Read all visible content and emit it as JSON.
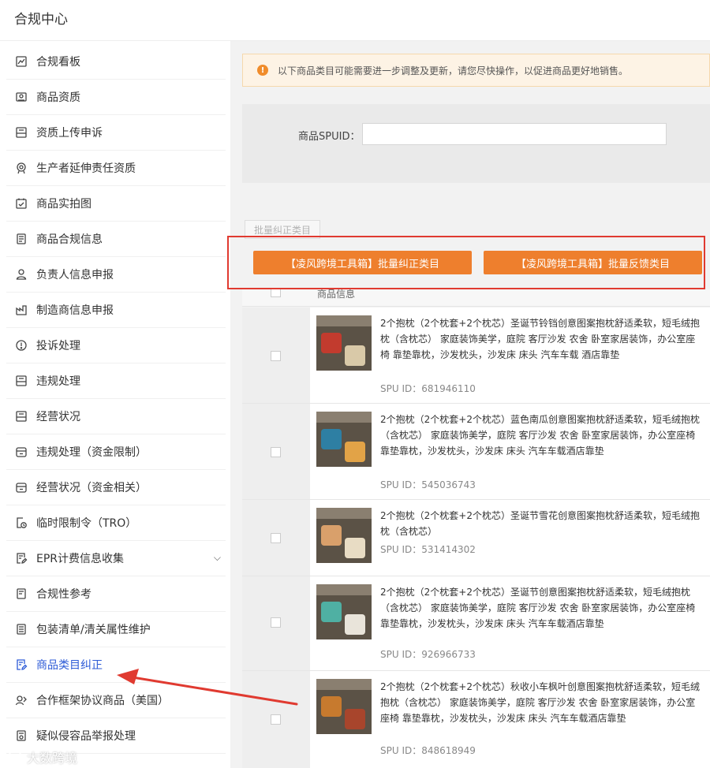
{
  "header": {
    "title": "合规中心"
  },
  "sidebar": {
    "items": [
      {
        "label": "合规看板",
        "icon": "chart-icon"
      },
      {
        "label": "商品资质",
        "icon": "id-card-icon"
      },
      {
        "label": "资质上传申诉",
        "icon": "upload-doc-icon"
      },
      {
        "label": "生产者延伸责任资质",
        "icon": "badge-icon"
      },
      {
        "label": "商品实拍图",
        "icon": "photo-icon"
      },
      {
        "label": "商品合规信息",
        "icon": "document-icon"
      },
      {
        "label": "负责人信息申报",
        "icon": "person-icon"
      },
      {
        "label": "制造商信息申报",
        "icon": "factory-icon"
      },
      {
        "label": "投诉处理",
        "icon": "alert-icon"
      },
      {
        "label": "违规处理",
        "icon": "folder-icon"
      },
      {
        "label": "经营状况",
        "icon": "folder-icon"
      },
      {
        "label": "违规处理（资金限制）",
        "icon": "wallet-icon"
      },
      {
        "label": "经营状况（资金相关）",
        "icon": "wallet-icon"
      },
      {
        "label": "临时限制令（TRO）",
        "icon": "clock-doc-icon"
      },
      {
        "label": "EPR计费信息收集",
        "icon": "edit-doc-icon",
        "expandable": true
      },
      {
        "label": "合规性参考",
        "icon": "book-icon"
      },
      {
        "label": "包装清单/清关属性维护",
        "icon": "list-doc-icon"
      },
      {
        "label": "商品类目纠正",
        "icon": "edit-doc-icon",
        "active": true
      },
      {
        "label": "合作框架协议商品（美国）",
        "icon": "handshake-icon"
      },
      {
        "label": "疑似侵容品举报处理",
        "icon": "report-icon"
      }
    ]
  },
  "notice": {
    "text": "以下商品类目可能需要进一步调整及更新，请您尽快操作，以促进商品更好地销售。"
  },
  "filter": {
    "label": "商品SPUID：",
    "value": ""
  },
  "actions": {
    "batch_correct_disabled": "批量纠正类目",
    "tool_correct": "【凌风跨境工具箱】批量纠正类目",
    "tool_feedback": "【凌风跨境工具箱】批量反馈类目"
  },
  "table": {
    "header": "商品信息",
    "rows": [
      {
        "desc": "2个抱枕（2个枕套+2个枕芯）圣诞节铃铛创意图案抱枕舒适柔软，短毛绒抱枕（含枕芯） 家庭装饰美学，庭院 客厅沙发 农舍 卧室家居装饰，办公室座椅 靠垫靠枕，沙发枕头，沙发床 床头 汽车车载 酒店靠垫",
        "spu": "SPU ID：681946110",
        "theme": "#c23b2e"
      },
      {
        "desc": "2个抱枕（2个枕套+2个枕芯）蓝色南瓜创意图案抱枕舒适柔软，短毛绒抱枕（含枕芯） 家庭装饰美学，庭院 客厅沙发 农舍 卧室家居装饰，办公室座椅 靠垫靠枕，沙发枕头，沙发床 床头 汽车车载酒店靠垫",
        "spu": "SPU ID：545036743",
        "theme": "#2e7fa3"
      },
      {
        "desc": "2个抱枕（2个枕套+2个枕芯）圣诞节雪花创意图案抱枕舒适柔软，短毛绒抱枕（含枕芯）",
        "spu": "SPU ID：531414302",
        "theme": "#d9a06b"
      },
      {
        "desc": "2个抱枕（2个枕套+2个枕芯）圣诞节创意图案抱枕舒适柔软，短毛绒抱枕（含枕芯） 家庭装饰美学，庭院 客厅沙发 农舍 卧室家居装饰，办公室座椅 靠垫靠枕，沙发枕头，沙发床 床头 汽车车载酒店靠垫",
        "spu": "SPU ID：926966733",
        "theme": "#4fb0a3"
      },
      {
        "desc": "2个抱枕（2个枕套+2个枕芯）秋收小车枫叶创意图案抱枕舒适柔软，短毛绒抱枕（含枕芯） 家庭装饰美学，庭院 客厅沙发 农舍 卧室家居装饰，办公室座椅 靠垫靠枕，沙发枕头，沙发床 床头 汽车车载酒店靠垫",
        "spu": "SPU ID：848618949",
        "theme": "#c77a2e"
      }
    ]
  },
  "watermark": {
    "text": "大数跨境"
  },
  "colors": {
    "accent_orange": "#ee7f2d",
    "highlight_red": "#e03a30",
    "active_blue": "#2d5bd7"
  }
}
